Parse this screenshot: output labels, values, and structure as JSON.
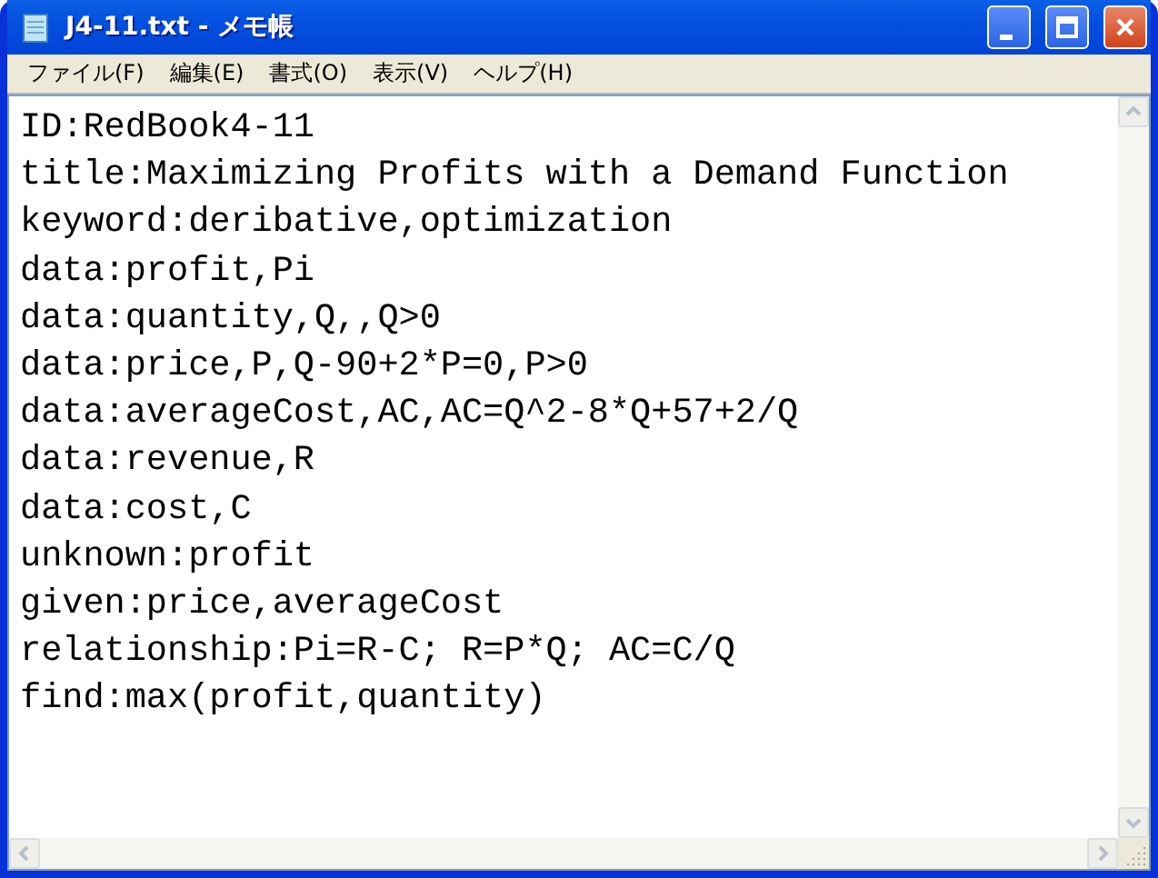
{
  "window": {
    "title": "J4-11.txt - メモ帳"
  },
  "menu": [
    "ファイル(F)",
    "編集(E)",
    "書式(O)",
    "表示(V)",
    "ヘルプ(H)"
  ],
  "lines": [
    "ID:RedBook4-11",
    "title:Maximizing Profits with a Demand Function",
    "keyword:deribative,optimization",
    "data:profit,Pi",
    "data:quantity,Q,,Q>0",
    "data:price,P,Q-90+2*P=0,P>0",
    "data:averageCost,AC,AC=Q^2-8*Q+57+2/Q",
    "data:revenue,R",
    "data:cost,C",
    "unknown:profit",
    "given:price,averageCost",
    "relationship:Pi=R-C; R=P*Q; AC=C/Q",
    "find:max(profit,quantity)"
  ]
}
